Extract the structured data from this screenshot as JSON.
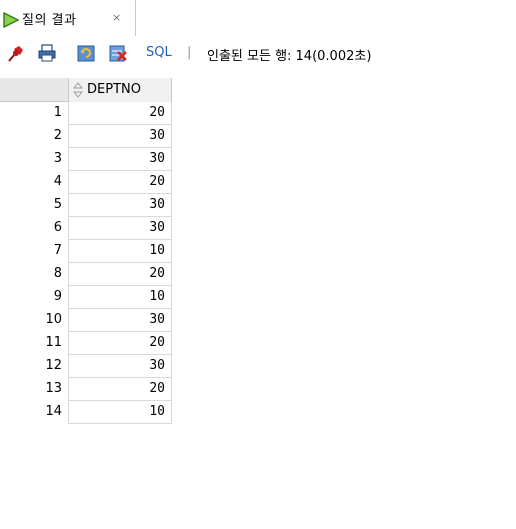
{
  "tab": {
    "title": "질의 결과",
    "close": "×",
    "icon": "play-icon"
  },
  "toolbar": {
    "icons": [
      "pin-icon",
      "print-icon",
      "refresh-icon",
      "cancel-export-icon"
    ],
    "sql_label": "SQL",
    "separator": "|",
    "status": "인출된 모든 행: 14(0.002초)"
  },
  "grid": {
    "columns": [
      "DEPTNO"
    ],
    "rows": [
      {
        "num": "1",
        "DEPTNO": "20"
      },
      {
        "num": "2",
        "DEPTNO": "30"
      },
      {
        "num": "3",
        "DEPTNO": "30"
      },
      {
        "num": "4",
        "DEPTNO": "20"
      },
      {
        "num": "5",
        "DEPTNO": "30"
      },
      {
        "num": "6",
        "DEPTNO": "30"
      },
      {
        "num": "7",
        "DEPTNO": "10"
      },
      {
        "num": "8",
        "DEPTNO": "20"
      },
      {
        "num": "9",
        "DEPTNO": "10"
      },
      {
        "num": "10",
        "DEPTNO": "30"
      },
      {
        "num": "11",
        "DEPTNO": "20"
      },
      {
        "num": "12",
        "DEPTNO": "30"
      },
      {
        "num": "13",
        "DEPTNO": "20"
      },
      {
        "num": "14",
        "DEPTNO": "10"
      }
    ]
  },
  "colors": {
    "sql_link": "#1f5fbf",
    "header_bg": "#e8e8e8"
  }
}
